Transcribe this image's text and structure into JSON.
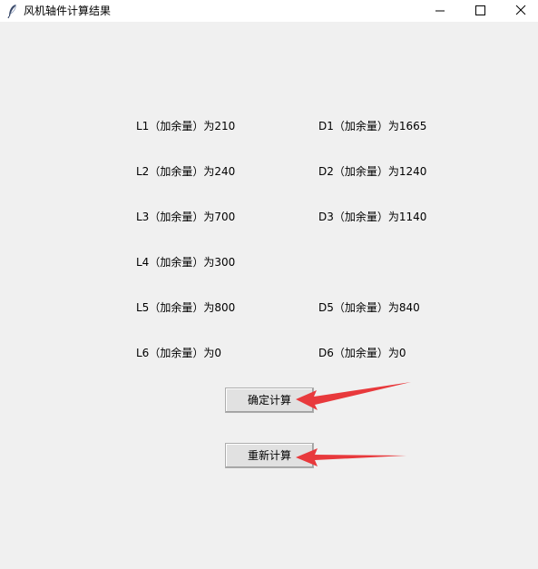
{
  "window": {
    "title": "风机轴件计算结果",
    "icons": {
      "app": "feather-icon",
      "minimize": "minimize-icon",
      "maximize": "maximize-icon",
      "close": "close-icon"
    }
  },
  "results": {
    "left": [
      "L1（加余量）为210",
      "L2（加余量）为240",
      "L3（加余量）为700",
      "L4（加余量）为300",
      "L5（加余量）为800",
      "L6（加余量）为0"
    ],
    "right": [
      "D1（加余量）为1665",
      "D2（加余量）为1240",
      "D3（加余量）为1140",
      "",
      "D5（加余量）为840",
      "D6（加余量）为0"
    ]
  },
  "buttons": {
    "confirm": "确定计算",
    "reset": "重新计算"
  },
  "annotations": {
    "arrow_color": "#e8393c"
  }
}
